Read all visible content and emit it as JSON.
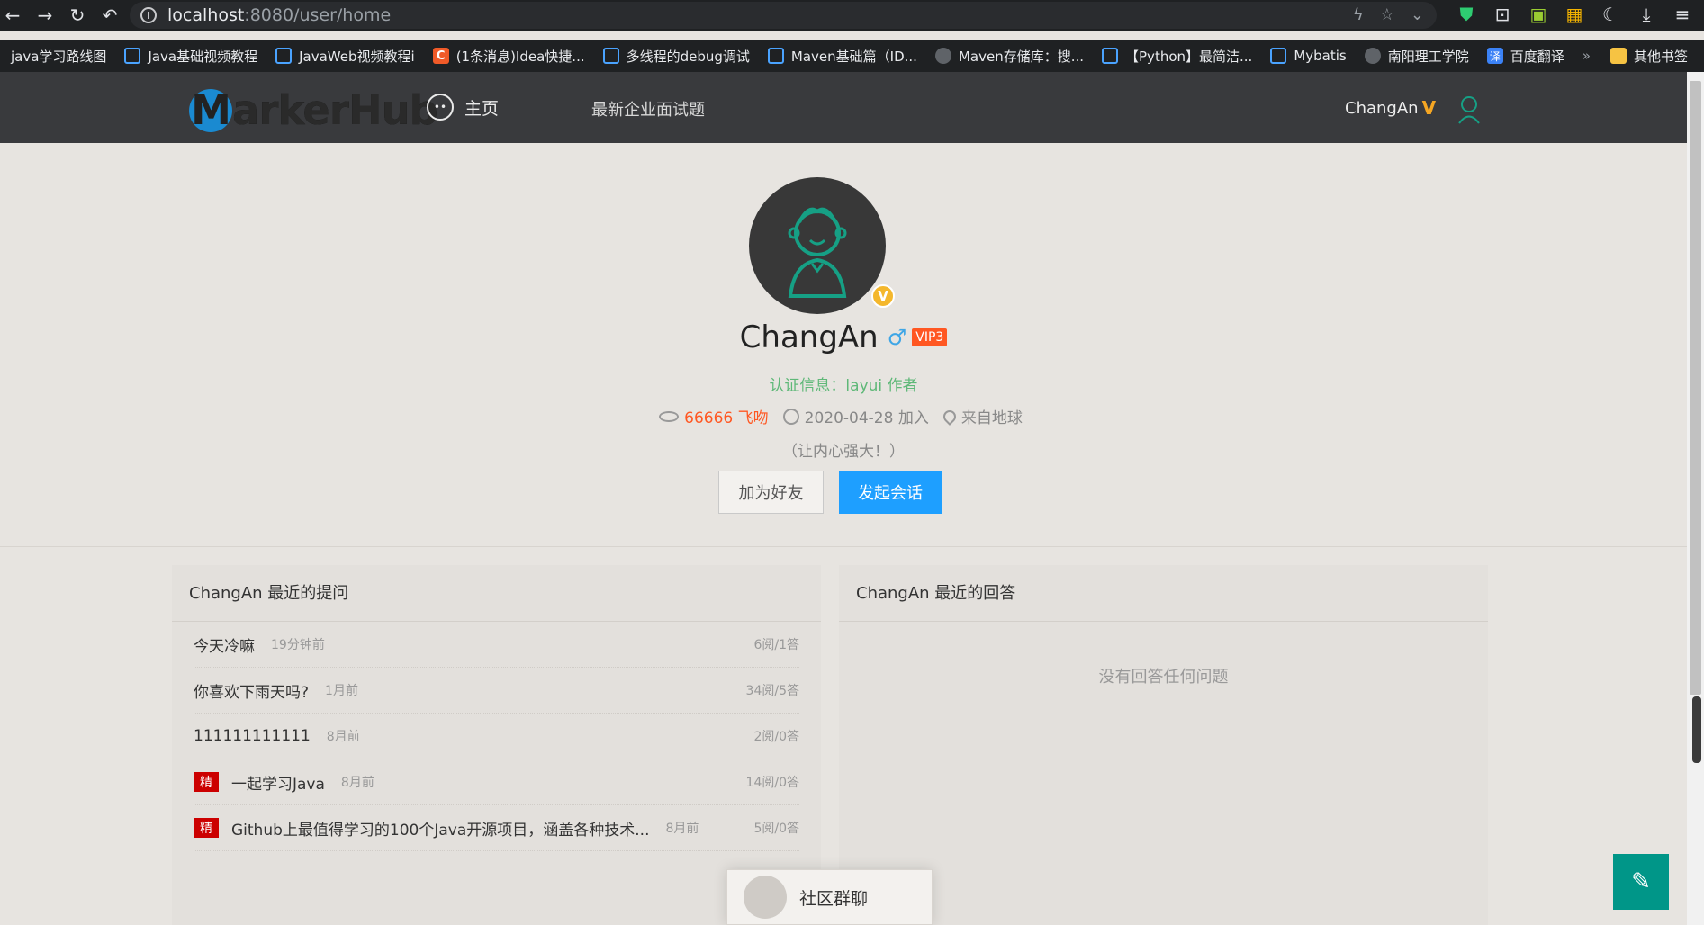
{
  "browser": {
    "url_host": "localhost",
    "url_path": ":8080/user/home",
    "bookmarks": [
      {
        "label": "java学习路线图",
        "icon": "none"
      },
      {
        "label": "Java基础视频教程",
        "icon": "bilibili-icon"
      },
      {
        "label": "JavaWeb视频教程i",
        "icon": "bilibili-icon"
      },
      {
        "label": "(1条消息)Idea快捷...",
        "icon": "csdn-icon"
      },
      {
        "label": "多线程的debug调试",
        "icon": "bilibili-icon"
      },
      {
        "label": "Maven基础篇（ID...",
        "icon": "bilibili-icon"
      },
      {
        "label": "Maven存储库：搜...",
        "icon": "globe-icon"
      },
      {
        "label": "【Python】最简洁...",
        "icon": "bilibili-icon"
      },
      {
        "label": "Mybatis",
        "icon": "bilibili-icon"
      },
      {
        "label": "南阳理工学院",
        "icon": "globe-icon"
      },
      {
        "label": "百度翻译",
        "icon": "translate-icon"
      }
    ],
    "more": "»",
    "other_bookmarks": "其他书签"
  },
  "header": {
    "logo_letter": "M",
    "logo_rest": "arkerHub",
    "nav_home": "主页",
    "nav_interview": "最新企业面试题",
    "user_name": "ChangAn",
    "user_badge": "V"
  },
  "profile": {
    "name": "ChangAn",
    "gender": "♂",
    "vip": "VIP3",
    "verified_badge": "V",
    "cert": "认证信息：layui 作者",
    "kiss": "66666 飞吻",
    "joined": "2020-04-28 加入",
    "location": "来自地球",
    "sign": "（让内心强大！）",
    "btn_friend": "加为好友",
    "btn_chat": "发起会话"
  },
  "questions": {
    "title": "ChangAn 最近的提问",
    "items": [
      {
        "title": "今天冷嘛",
        "time": "19分钟前",
        "stat": "6阅/1答",
        "jing": ""
      },
      {
        "title": "你喜欢下雨天吗?",
        "time": "1月前",
        "stat": "34阅/5答",
        "jing": ""
      },
      {
        "title": "111111111111",
        "time": "8月前",
        "stat": "2阅/0答",
        "jing": ""
      },
      {
        "title": "一起学习Java",
        "time": "8月前",
        "stat": "14阅/0答",
        "jing": "精"
      },
      {
        "title": "Github上最值得学习的100个Java开源项目，涵盖各种技术...",
        "time": "8月前",
        "stat": "5阅/0答",
        "jing": "精"
      }
    ]
  },
  "answers": {
    "title": "ChangAn 最近的回答",
    "empty": "没有回答任何问题"
  },
  "floating": {
    "group_chat": "社区群聊"
  },
  "colors": {
    "accent_blue": "#1e9fff",
    "vip_orange": "#ff5722",
    "cert_green": "#5fb878",
    "fab_teal": "#009688",
    "jing_red": "#cc0000"
  }
}
